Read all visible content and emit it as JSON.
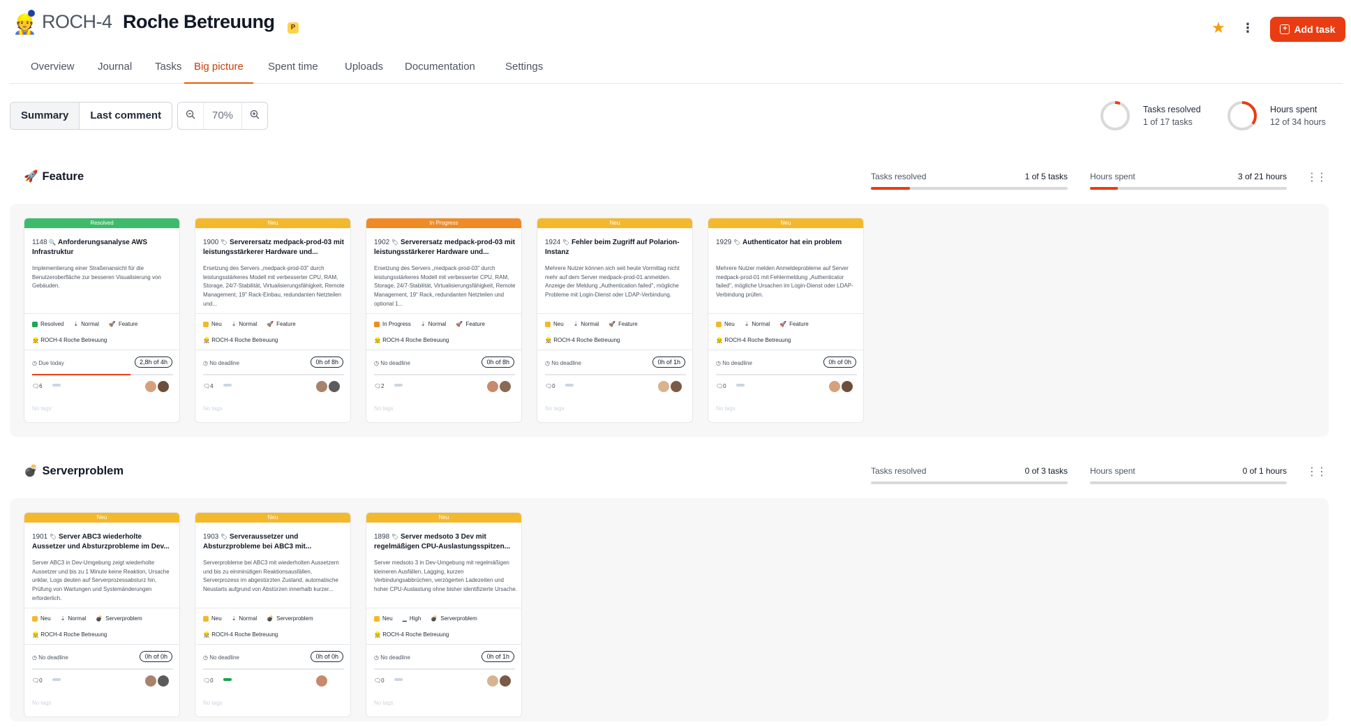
{
  "header": {
    "project_key": "ROCH-4",
    "project_name": "Roche Betreuung",
    "badge": "P",
    "add_task_label": "Add task"
  },
  "tabs": [
    "Overview",
    "Journal",
    "Tasks",
    "Big picture",
    "Spent time",
    "Uploads",
    "Documentation",
    "Settings"
  ],
  "active_tab": "Big picture",
  "toolbar": {
    "views": [
      "Summary",
      "Last comment"
    ],
    "selected_view": "Summary",
    "zoom": "70%"
  },
  "summary": {
    "tasks_label": "Tasks resolved",
    "tasks_value": "1 of 17 tasks",
    "tasks_fraction": 0.0588,
    "hours_label": "Hours spent",
    "hours_value": "12 of 34 hours",
    "hours_fraction": 0.353
  },
  "groups": [
    {
      "icon": "🚀",
      "name": "Feature",
      "tasks_label": "Tasks resolved",
      "tasks_value": "1 of 5 tasks",
      "tasks_fraction": 0.2,
      "hours_label": "Hours spent",
      "hours_value": "3 of 21 hours",
      "hours_fraction": 0.143,
      "cards": [
        {
          "status": "Resolved",
          "status_color": "#3dbb6a",
          "id": "1148",
          "icon": "🔍",
          "title": "Anforderungsanalyse AWS Infrastruktur",
          "desc": "Implementierung einer Straßenansicht für die Benutzeroberfläche zur besseren Visualisierung von Gebäuden.",
          "priority": "Normal",
          "tracker": "Feature",
          "project": "ROCH-4 Roche Betreuung",
          "deadline": "Due today",
          "hours": "2,8h of 4h",
          "progress": 0.7,
          "comments": "6",
          "tags": "No tags"
        },
        {
          "status": "Neu",
          "status_color": "#f4b82d",
          "id": "1900",
          "icon": "🏷",
          "title": "Serverersatz medpack-prod-03 mit leistungsstärkerer Hardware und...",
          "desc": "Ersetzung des Servers „medpack-prod-03\" durch leistungsstärkeres Modell mit verbesserter CPU, RAM, Storage, 24/7-Stabilität, Virtualisierungsfähigkeit, Remote Management, 19\" Rack-Einbau, redundanten Netzteilen und...",
          "priority": "Normal",
          "tracker": "Feature",
          "project": "ROCH-4 Roche Betreuung",
          "deadline": "No deadline",
          "hours": "0h of 8h",
          "progress": 0,
          "comments": "4",
          "tags": "No tags"
        },
        {
          "status": "In Progress",
          "status_color": "#f08a24",
          "id": "1902",
          "icon": "🏷",
          "title": "Serverersatz medpack-prod-03 mit leistungsstärkerer Hardware und...",
          "desc": "Ersetzung des Servers „medpack-prod-03\" durch leistungsstärkeres Modell mit verbesserter CPU, RAM, Storage, 24/7-Stabilität, Virtualisierungsfähigkeit, Remote Management, 19\" Rack, redundanten Netzteilen und optional 1...",
          "priority": "Normal",
          "tracker": "Feature",
          "project": "ROCH-4 Roche Betreuung",
          "deadline": "No deadline",
          "hours": "0h of 8h",
          "progress": 0,
          "comments": "2",
          "tags": "No tags"
        },
        {
          "status": "Neu",
          "status_color": "#f4b82d",
          "id": "1924",
          "icon": "🏷",
          "title": "Fehler beim Zugriff auf Polarion-Instanz",
          "desc": "Mehrere Nutzer können sich seit heute Vormittag nicht mehr auf dem Server medpack-prod-01 anmelden. Anzeige der Meldung „Authentication failed\", mögliche Probleme mit Login-Dienst oder LDAP-Verbindung.",
          "priority": "Normal",
          "tracker": "Feature",
          "project": "ROCH-4 Roche Betreuung",
          "deadline": "No deadline",
          "hours": "0h of 1h",
          "progress": 0,
          "comments": "0",
          "tags": "No tags"
        },
        {
          "status": "Neu",
          "status_color": "#f4b82d",
          "id": "1929",
          "icon": "🏷",
          "title": "Authenticator hat ein problem",
          "desc": "Mehrere Nutzer melden Anmeldeprobleme auf Server medpack-prod-01 mit Fehlermeldung „Authenticator failed\", mögliche Ursachen im Login-Dienst oder LDAP-Verbindung prüfen.",
          "priority": "Normal",
          "tracker": "Feature",
          "project": "ROCH-4 Roche Betreuung",
          "deadline": "No deadline",
          "hours": "0h of 0h",
          "progress": 0,
          "comments": "0",
          "tags": "No tags"
        }
      ]
    },
    {
      "icon": "💣",
      "name": "Serverproblem",
      "tasks_label": "Tasks resolved",
      "tasks_value": "0 of 3 tasks",
      "tasks_fraction": 0,
      "hours_label": "Hours spent",
      "hours_value": "0 of 1 hours",
      "hours_fraction": 0,
      "cards": [
        {
          "status": "Neu",
          "status_color": "#f4b82d",
          "id": "1901",
          "icon": "🏷",
          "title": "Server ABC3 wiederholte Aussetzer und Absturzprobleme im Dev...",
          "desc": "Server ABC3 in Dev-Umgebung zeigt wiederholte Aussetzer und bis zu 1 Minute keine Reaktion, Ursache unklar, Logs deuten auf Serverprozessabsturz hin, Prüfung von Wartungen und Systemänderungen erforderlich.",
          "priority": "Normal",
          "tracker": "Serverproblem",
          "project": "ROCH-4 Roche Betreuung",
          "deadline": "No deadline",
          "hours": "0h of 0h",
          "progress": 0,
          "comments": "0",
          "tags": "No tags"
        },
        {
          "status": "Neu",
          "status_color": "#f4b82d",
          "id": "1903",
          "icon": "🏷",
          "title": "Serveraussetzer und Absturzprobleme bei ABC3 mit...",
          "desc": "Serverprobleme bei ABC3 mit wiederholten Aussetzern und bis zu einminütigen Reaktionsausfällen, Serverprozess im abgestürzten Zustand, automatische Neustarts aufgrund von Abstürzen innerhalb kurzer...",
          "priority": "Normal",
          "tracker": "Serverproblem",
          "project": "ROCH-4 Roche Betreuung",
          "deadline": "No deadline",
          "hours": "0h of 0h",
          "progress": 0,
          "comments": "0",
          "tags": "No tags"
        },
        {
          "status": "Neu",
          "status_color": "#f4b82d",
          "id": "1898",
          "icon": "🏷",
          "title": "Server medsoto 3 Dev mit regelmäßigen CPU-Auslastungsspitzen...",
          "desc": "Server medsoto 3 in Dev-Umgebung mit regelmäßigen kleineren Ausfällen, Lagging, kurzen Verbindungsabbrüchen, verzögerten Ladezeiten und hoher CPU-Auslastung ohne bisher identifizierte Ursache.",
          "priority": "High",
          "tracker": "Serverproblem",
          "project": "ROCH-4 Roche Betreuung",
          "deadline": "No deadline",
          "hours": "0h of 1h",
          "progress": 0,
          "comments": "0",
          "tags": "No tags"
        }
      ]
    }
  ]
}
